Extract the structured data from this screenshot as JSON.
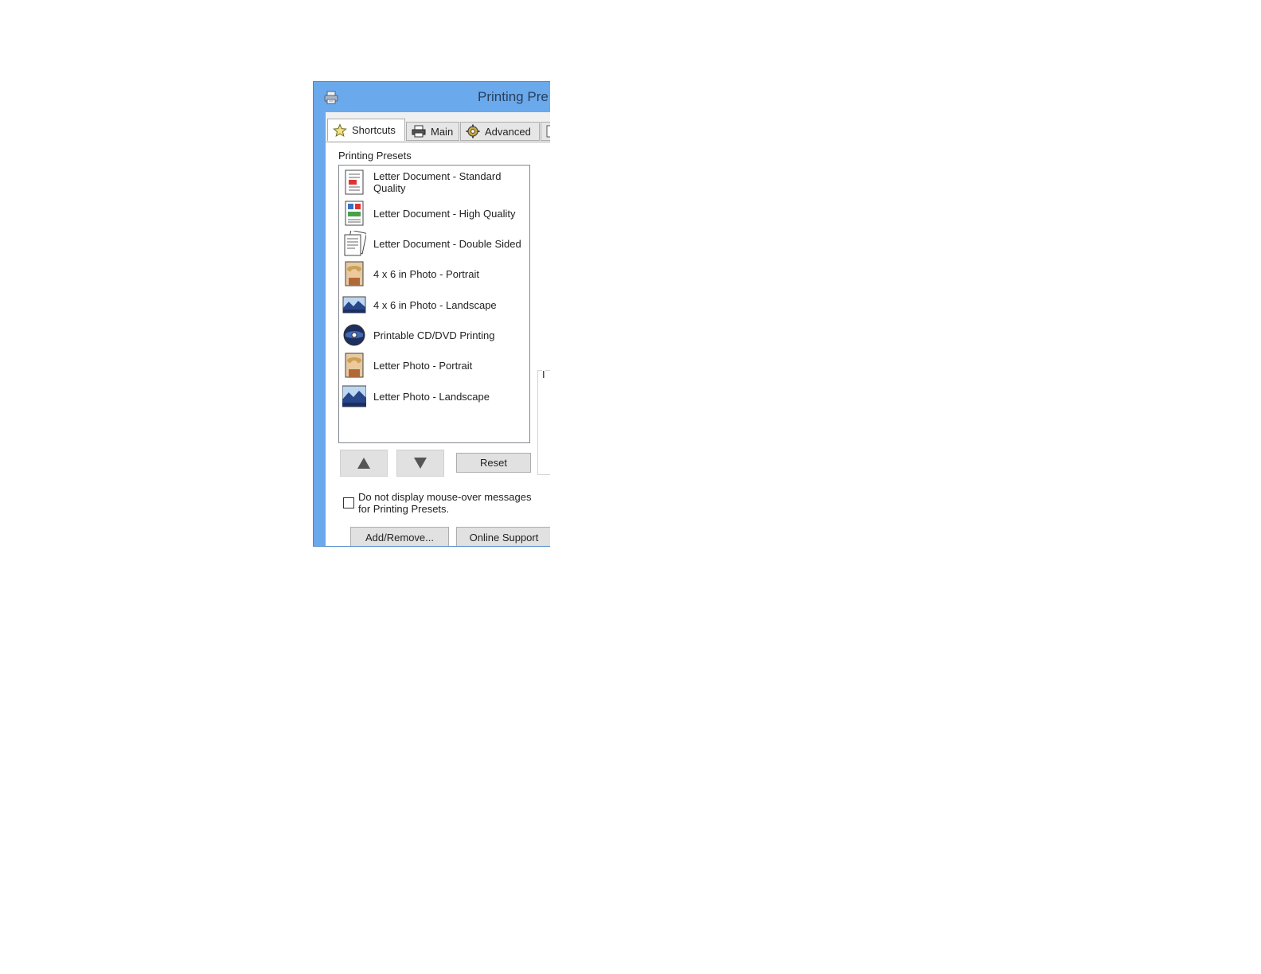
{
  "window": {
    "title": "Printing Pre"
  },
  "tabs": [
    {
      "label": "Shortcuts",
      "icon": "star-icon",
      "active": true
    },
    {
      "label": "Main",
      "icon": "printer-icon",
      "active": false
    },
    {
      "label": "Advanced",
      "icon": "gear-icon",
      "active": false
    },
    {
      "label": "",
      "icon": "page-icon",
      "active": false
    }
  ],
  "presets": {
    "label": "Printing Presets",
    "items": [
      {
        "label": "Letter Document - Standard Quality",
        "icon": "document-standard-icon"
      },
      {
        "label": "Letter Document - High Quality",
        "icon": "document-high-quality-icon"
      },
      {
        "label": "Letter Document - Double Sided",
        "icon": "document-double-sided-icon"
      },
      {
        "label": "4 x 6 in Photo - Portrait",
        "icon": "photo-portrait-icon"
      },
      {
        "label": "4 x 6 in Photo - Landscape",
        "icon": "photo-landscape-icon"
      },
      {
        "label": "Printable CD/DVD Printing",
        "icon": "cd-dvd-icon"
      },
      {
        "label": "Letter Photo - Portrait",
        "icon": "photo-portrait-icon"
      },
      {
        "label": "Letter Photo - Landscape",
        "icon": "photo-landscape-icon"
      }
    ]
  },
  "buttons": {
    "reset": "Reset",
    "add_remove": "Add/Remove...",
    "online_support": "Online Support"
  },
  "checkbox": {
    "label": "Do not display mouse-over messages for Printing Presets.",
    "checked": false
  },
  "side_group": {
    "label": "I"
  },
  "colors": {
    "titlebar": "#6aa9ec",
    "panel": "#ffffff",
    "button": "#e1e1e1"
  }
}
